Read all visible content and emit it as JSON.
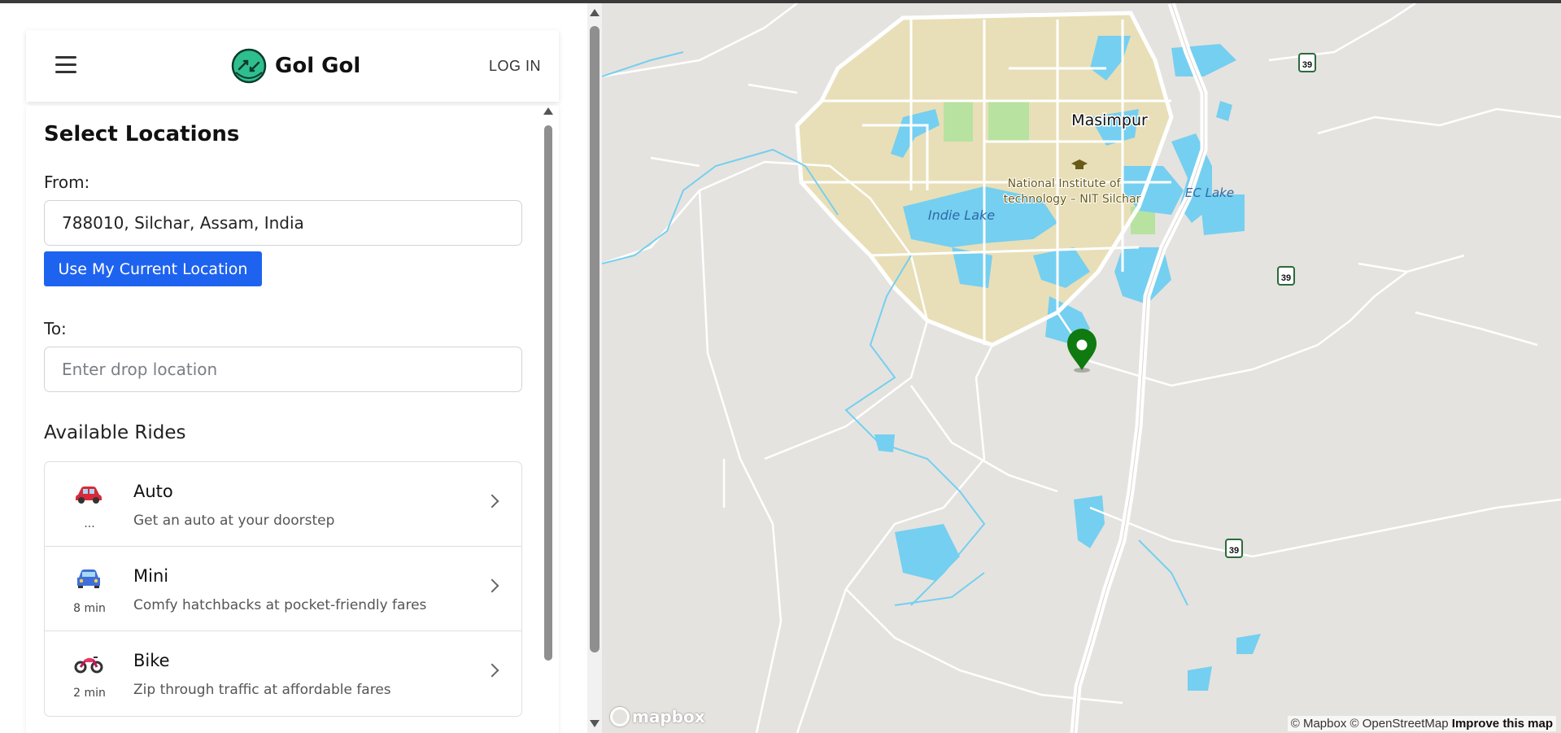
{
  "app": {
    "name": "Gol Gol",
    "login_label": "LOG IN"
  },
  "form": {
    "title": "Select Locations",
    "from_label": "From:",
    "from_value": "788010, Silchar, Assam, India",
    "current_location_button": "Use My Current Location",
    "to_label": "To:",
    "to_placeholder": "Enter drop location"
  },
  "rides": {
    "title": "Available Rides",
    "items": [
      {
        "name": "Auto",
        "description": "Get an auto at your doorstep",
        "eta": "...",
        "icon": "car-icon"
      },
      {
        "name": "Mini",
        "description": "Comfy hatchbacks at pocket-friendly fares",
        "eta": "8 min",
        "icon": "car-front-icon"
      },
      {
        "name": "Bike",
        "description": "Zip through traffic at affordable fares",
        "eta": "2 min",
        "icon": "motorbike-icon"
      }
    ]
  },
  "map": {
    "labels": {
      "town": "Masimpur",
      "institute_line1": "National Institute of",
      "institute_line2": "technology – NIT Silchar",
      "lake1": "Indie Lake",
      "lake2": "EC Lake",
      "highway": "39"
    },
    "attribution": {
      "text": "© Mapbox © OpenStreetMap",
      "improve": "Improve this map"
    },
    "logo": "mapbox"
  },
  "colors": {
    "primary": "#1e63f0",
    "marker": "#0f7a0f",
    "water": "#75cff0",
    "campus": "#e8dfb8",
    "park": "#b7e2a0"
  }
}
